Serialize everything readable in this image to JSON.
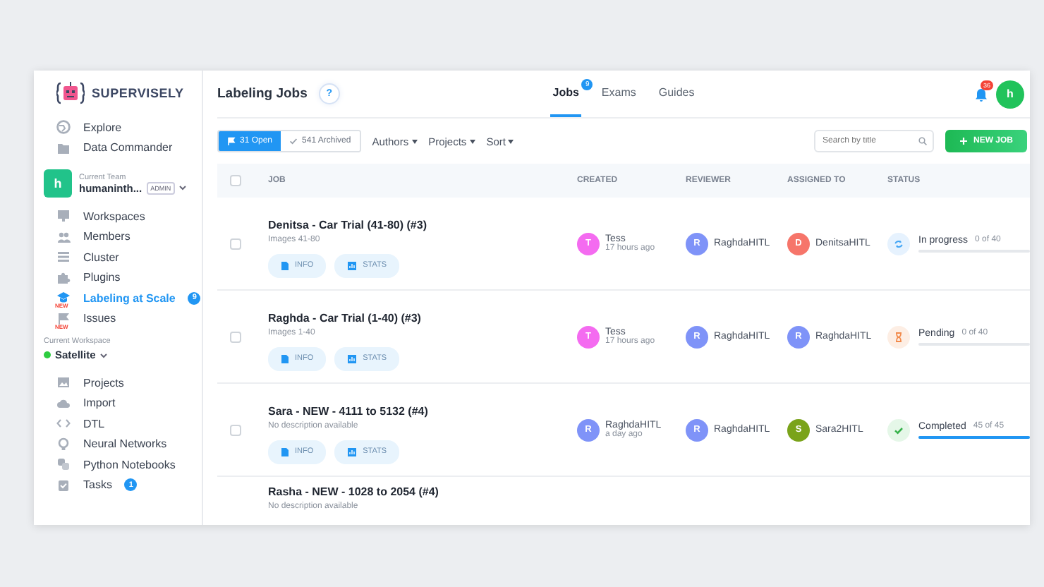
{
  "sidebar": {
    "logo": "SUPERVISELY",
    "top_items": [
      {
        "label": "Explore",
        "selected": false
      },
      {
        "label": "Data Commander",
        "selected": false
      }
    ],
    "team": {
      "avatar": "h",
      "caption": "Current Team",
      "name": "humaninth...",
      "role": "ADMIN"
    },
    "team_items": [
      {
        "label": "Workspaces",
        "selected": false
      },
      {
        "label": "Members",
        "selected": false
      },
      {
        "label": "Cluster",
        "selected": false
      },
      {
        "label": "Plugins",
        "selected": false
      },
      {
        "label": "Labeling at Scale",
        "selected": true,
        "new_tag": "NEW",
        "badge": "9"
      },
      {
        "label": "Issues",
        "selected": false,
        "new_tag": "NEW"
      }
    ],
    "workspace": {
      "caption": "Current Workspace",
      "name": "Satellite"
    },
    "workspace_items": [
      {
        "label": "Projects",
        "selected": false
      },
      {
        "label": "Import",
        "selected": false
      },
      {
        "label": "DTL",
        "selected": false
      },
      {
        "label": "Neural Networks",
        "selected": false
      },
      {
        "label": "Python Notebooks",
        "selected": false
      },
      {
        "label": "Tasks",
        "selected": false,
        "badge": "1"
      }
    ]
  },
  "header": {
    "title": "Labeling Jobs",
    "help": "?",
    "tabs": [
      {
        "label": "Jobs",
        "selected": true,
        "badge": "9"
      },
      {
        "label": "Exams",
        "selected": false
      },
      {
        "label": "Guides",
        "selected": false
      }
    ],
    "notifications": "36",
    "user": "h"
  },
  "toolbar": {
    "filters": [
      {
        "label": "31 Open",
        "selected": true
      },
      {
        "label": "541 Archived",
        "selected": false
      }
    ],
    "dropdowns": [
      "Authors",
      "Projects",
      "Sort"
    ],
    "search": {
      "placeholder": "Search by title"
    },
    "new_job": "NEW JOB"
  },
  "table": {
    "select_all": {
      "checked": false
    },
    "columns": [
      "JOB",
      "CREATED",
      "REVIEWER",
      "ASSIGNED TO",
      "STATUS"
    ],
    "rows": [
      {
        "checked": false,
        "title": "Denitsa - Car Trial (41-80) (#3)",
        "description": "Images 41-80",
        "buttons": [
          "INFO",
          "STATS"
        ],
        "created": {
          "initial": "T",
          "name": "Tess",
          "time": "17 hours ago",
          "color": "#f46bf0"
        },
        "reviewer": {
          "initial": "R",
          "name": "RaghdaHITL",
          "color": "#7f93f8"
        },
        "assignee": {
          "initial": "D",
          "name": "DenitsaHITL",
          "color": "#f6756a"
        },
        "status": {
          "kind": "in_progress",
          "label": "In progress",
          "count": "0 of 40",
          "level": 0
        }
      },
      {
        "checked": false,
        "title": "Raghda - Car Trial (1-40) (#3)",
        "description": "Images 1-40",
        "buttons": [
          "INFO",
          "STATS"
        ],
        "created": {
          "initial": "T",
          "name": "Tess",
          "time": "17 hours ago",
          "color": "#f46bf0"
        },
        "reviewer": {
          "initial": "R",
          "name": "RaghdaHITL",
          "color": "#7f93f8"
        },
        "assignee": {
          "initial": "R",
          "name": "RaghdaHITL",
          "color": "#7f93f8"
        },
        "status": {
          "kind": "pending",
          "label": "Pending",
          "count": "0 of 40",
          "level": 0
        }
      },
      {
        "checked": false,
        "title": "Sara - NEW - 4111 to 5132 (#4)",
        "description": "No description available",
        "buttons": [
          "INFO",
          "STATS"
        ],
        "created": {
          "initial": "R",
          "name": "RaghdaHITL",
          "time": "a day ago",
          "color": "#7f93f8"
        },
        "reviewer": {
          "initial": "R",
          "name": "RaghdaHITL",
          "color": "#7f93f8"
        },
        "assignee": {
          "initial": "S",
          "name": "Sara2HITL",
          "color": "#7aa31a"
        },
        "status": {
          "kind": "completed",
          "label": "Completed",
          "count": "45 of 45",
          "level": 1
        }
      },
      {
        "title": "Rasha - NEW - 1028 to 2054 (#4)",
        "description": "No description available"
      }
    ]
  }
}
